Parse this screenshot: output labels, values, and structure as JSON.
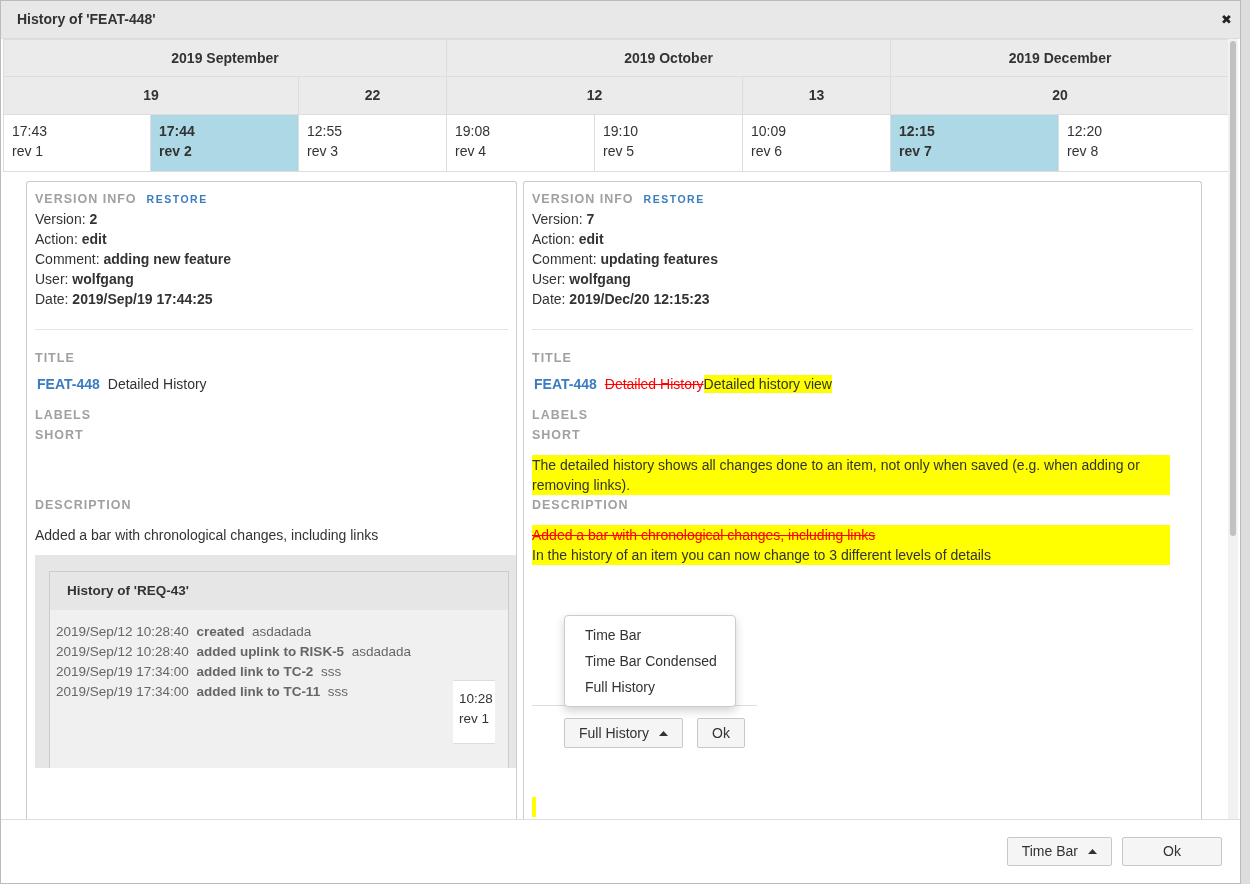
{
  "window": {
    "title": "History of 'FEAT-448'",
    "close": "✖"
  },
  "timeline": {
    "months": [
      {
        "label": "2019 September",
        "days": [
          {
            "label": "19",
            "revisions": [
              {
                "time": "17:43",
                "rev": "rev 1",
                "selected": false
              },
              {
                "time": "17:44",
                "rev": "rev 2",
                "selected": true
              }
            ]
          },
          {
            "label": "22",
            "revisions": [
              {
                "time": "12:55",
                "rev": "rev 3",
                "selected": false
              }
            ]
          }
        ]
      },
      {
        "label": "2019 October",
        "days": [
          {
            "label": "12",
            "revisions": [
              {
                "time": "19:08",
                "rev": "rev 4",
                "selected": false
              },
              {
                "time": "19:10",
                "rev": "rev 5",
                "selected": false
              }
            ]
          },
          {
            "label": "13",
            "revisions": [
              {
                "time": "10:09",
                "rev": "rev 6",
                "selected": false
              }
            ]
          }
        ]
      },
      {
        "label": "2019 December",
        "days": [
          {
            "label": "20",
            "revisions": [
              {
                "time": "12:15",
                "rev": "rev 7",
                "selected": true
              },
              {
                "time": "12:20",
                "rev": "rev 8",
                "selected": false
              }
            ]
          }
        ]
      }
    ]
  },
  "versions": [
    {
      "heading": "VERSION INFO",
      "restore": "RESTORE",
      "fields": [
        {
          "label": "Version:",
          "value": "2"
        },
        {
          "label": "Action:",
          "value": "edit"
        },
        {
          "label": "Comment:",
          "value": "adding new feature"
        },
        {
          "label": "User:",
          "value": "wolfgang"
        },
        {
          "label": "Date:",
          "value": "2019/Sep/19 17:44:25"
        }
      ],
      "title_heading": "TITLE",
      "item_id": "FEAT-448",
      "title_segments": [
        {
          "text": "Detailed History"
        }
      ],
      "labels_heading": "LABELS",
      "short_heading": "SHORT",
      "description_heading": "DESCRIPTION",
      "description": {
        "highlighted": false,
        "lines": [
          {
            "text": "Added a bar with chronological changes, including links"
          }
        ]
      },
      "embedded_screenshot": {
        "title": "History of 'REQ-43'",
        "entries": [
          {
            "date": "2019/Sep/12 10:28:40",
            "action": "created",
            "comment": "asdadada"
          },
          {
            "date": "2019/Sep/12 10:28:40",
            "action": "added uplink to RISK-5",
            "comment": "asdadada"
          },
          {
            "date": "2019/Sep/19 17:34:00",
            "action": "added link to TC-2",
            "comment": "sss"
          },
          {
            "date": "2019/Sep/19 17:34:00",
            "action": "added link to TC-11",
            "comment": "sss"
          }
        ],
        "side_time": "10:28",
        "side_rev": "rev 1"
      }
    },
    {
      "heading": "VERSION INFO",
      "restore": "RESTORE",
      "fields": [
        {
          "label": "Version:",
          "value": "7"
        },
        {
          "label": "Action:",
          "value": "edit"
        },
        {
          "label": "Comment:",
          "value": "updating features"
        },
        {
          "label": "User:",
          "value": "wolfgang"
        },
        {
          "label": "Date:",
          "value": "2019/Dec/20 12:15:23"
        }
      ],
      "title_heading": "TITLE",
      "item_id": "FEAT-448",
      "title_segments": [
        {
          "text": "Detailed History",
          "kind": "deleted"
        },
        {
          "text": "Detailed history view",
          "kind": "added"
        }
      ],
      "labels_heading": "LABELS",
      "short_heading": "SHORT",
      "short": {
        "highlighted": true,
        "lines": [
          {
            "text": "The detailed history shows all changes done to an item, not only when saved (e.g. when adding or removing links)."
          }
        ]
      },
      "description_heading": "DESCRIPTION",
      "description": {
        "highlighted": true,
        "lines": [
          {
            "text": "Added a bar with chronological changes, including links",
            "kind": "deleted"
          },
          {
            "text": "In the history of an item you can now change to 3 different levels of details"
          }
        ]
      },
      "embedded_menu": {
        "items": [
          {
            "label": "Time Bar"
          },
          {
            "label": "Time Bar Condensed"
          },
          {
            "label": "Full History"
          }
        ],
        "button": "Full History",
        "ok": "Ok"
      }
    }
  ],
  "footer": {
    "view_button": "Time Bar",
    "ok": "Ok"
  }
}
